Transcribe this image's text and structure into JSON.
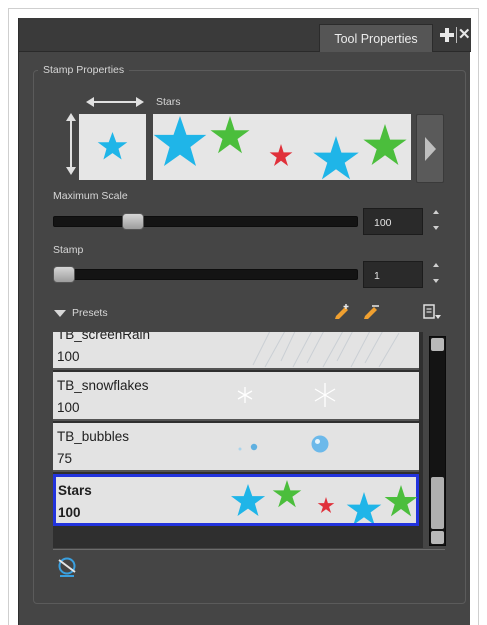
{
  "panel": {
    "tab_title": "Tool Properties",
    "group_title": "Stamp Properties",
    "stamp_name": "Stars"
  },
  "maximum_scale": {
    "label": "Maximum Scale",
    "value": "100",
    "level": 0.23
  },
  "stamp": {
    "label": "Stamp",
    "value": "1",
    "level": 0.0
  },
  "presets": {
    "label": "Presets",
    "items": [
      {
        "name": "TB_screenRain",
        "value": "100",
        "selected": false
      },
      {
        "name": "TB_snowflakes",
        "value": "100",
        "selected": false
      },
      {
        "name": "TB_bubbles",
        "value": "75",
        "selected": false
      },
      {
        "name": "Stars",
        "value": "100",
        "selected": true
      }
    ]
  },
  "colors": {
    "panel_bg": "#454545",
    "star_blue": "#1fb5e8",
    "star_green": "#4bbe3c",
    "star_red": "#e0303a",
    "selection": "#2233dd"
  },
  "icons": [
    "add-icon",
    "close-icon",
    "double-arrow-icon",
    "next-arrow-icon",
    "new-preset-icon",
    "rename-preset-icon",
    "presets-menu-icon",
    "plugin-icon"
  ]
}
